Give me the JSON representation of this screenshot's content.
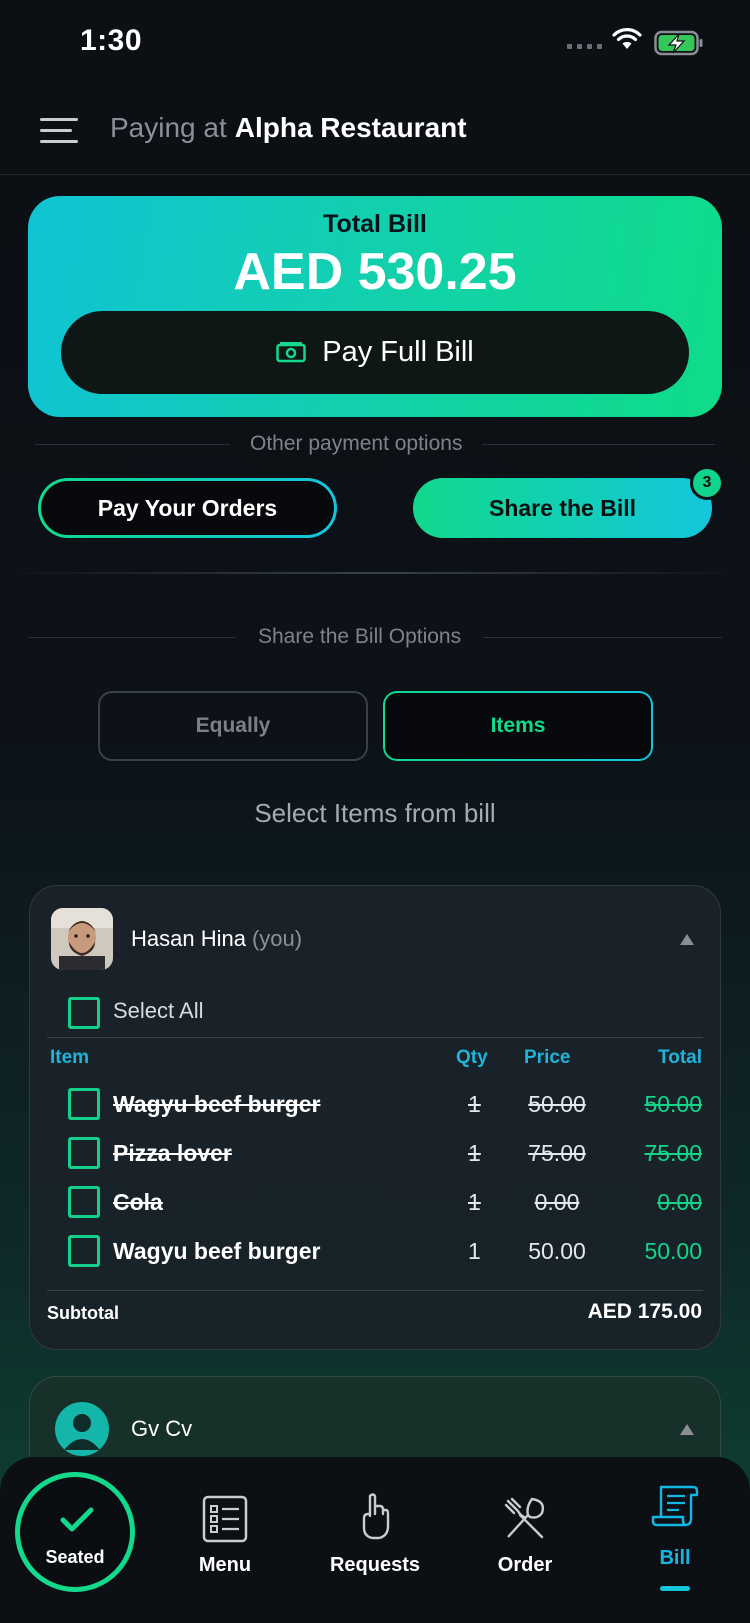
{
  "status_bar": {
    "time": "1:30"
  },
  "header": {
    "prefix": "Paying at",
    "restaurant": "Alpha Restaurant"
  },
  "total_card": {
    "label": "Total Bill",
    "amount": "AED 530.25",
    "pay_full_label": "Pay Full Bill"
  },
  "other_options_label": "Other payment options",
  "buttons": {
    "pay_orders": "Pay Your Orders",
    "share_bill": "Share the Bill",
    "share_badge": "3"
  },
  "share_options": {
    "label": "Share the Bill Options",
    "segments": [
      "Equally",
      "Items"
    ],
    "selected": "Items",
    "hint": "Select Items from bill"
  },
  "people": [
    {
      "name": "Hasan Hina",
      "you_tag": "(you)",
      "select_all_label": "Select All",
      "headers": {
        "item": "Item",
        "qty": "Qty",
        "price": "Price",
        "total": "Total"
      },
      "items": [
        {
          "name": "Wagyu beef burger",
          "qty": "1",
          "price": "50.00",
          "total": "50.00",
          "paid": true
        },
        {
          "name": "Pizza lover",
          "qty": "1",
          "price": "75.00",
          "total": "75.00",
          "paid": true
        },
        {
          "name": "Cola",
          "qty": "1",
          "price": "0.00",
          "total": "0.00",
          "paid": true
        },
        {
          "name": "Wagyu beef burger",
          "qty": "1",
          "price": "50.00",
          "total": "50.00",
          "paid": false
        }
      ],
      "subtotal_label": "Subtotal",
      "subtotal_value": "AED 175.00"
    },
    {
      "name": "Gv Cv"
    }
  ],
  "tabbar": {
    "seated": "Seated",
    "tabs": [
      "Menu",
      "Requests",
      "Order",
      "Bill"
    ],
    "active": "Bill"
  },
  "colors": {
    "accent_green": "#12d98c",
    "accent_cyan": "#14c3dd",
    "background": "#0c0f14"
  }
}
